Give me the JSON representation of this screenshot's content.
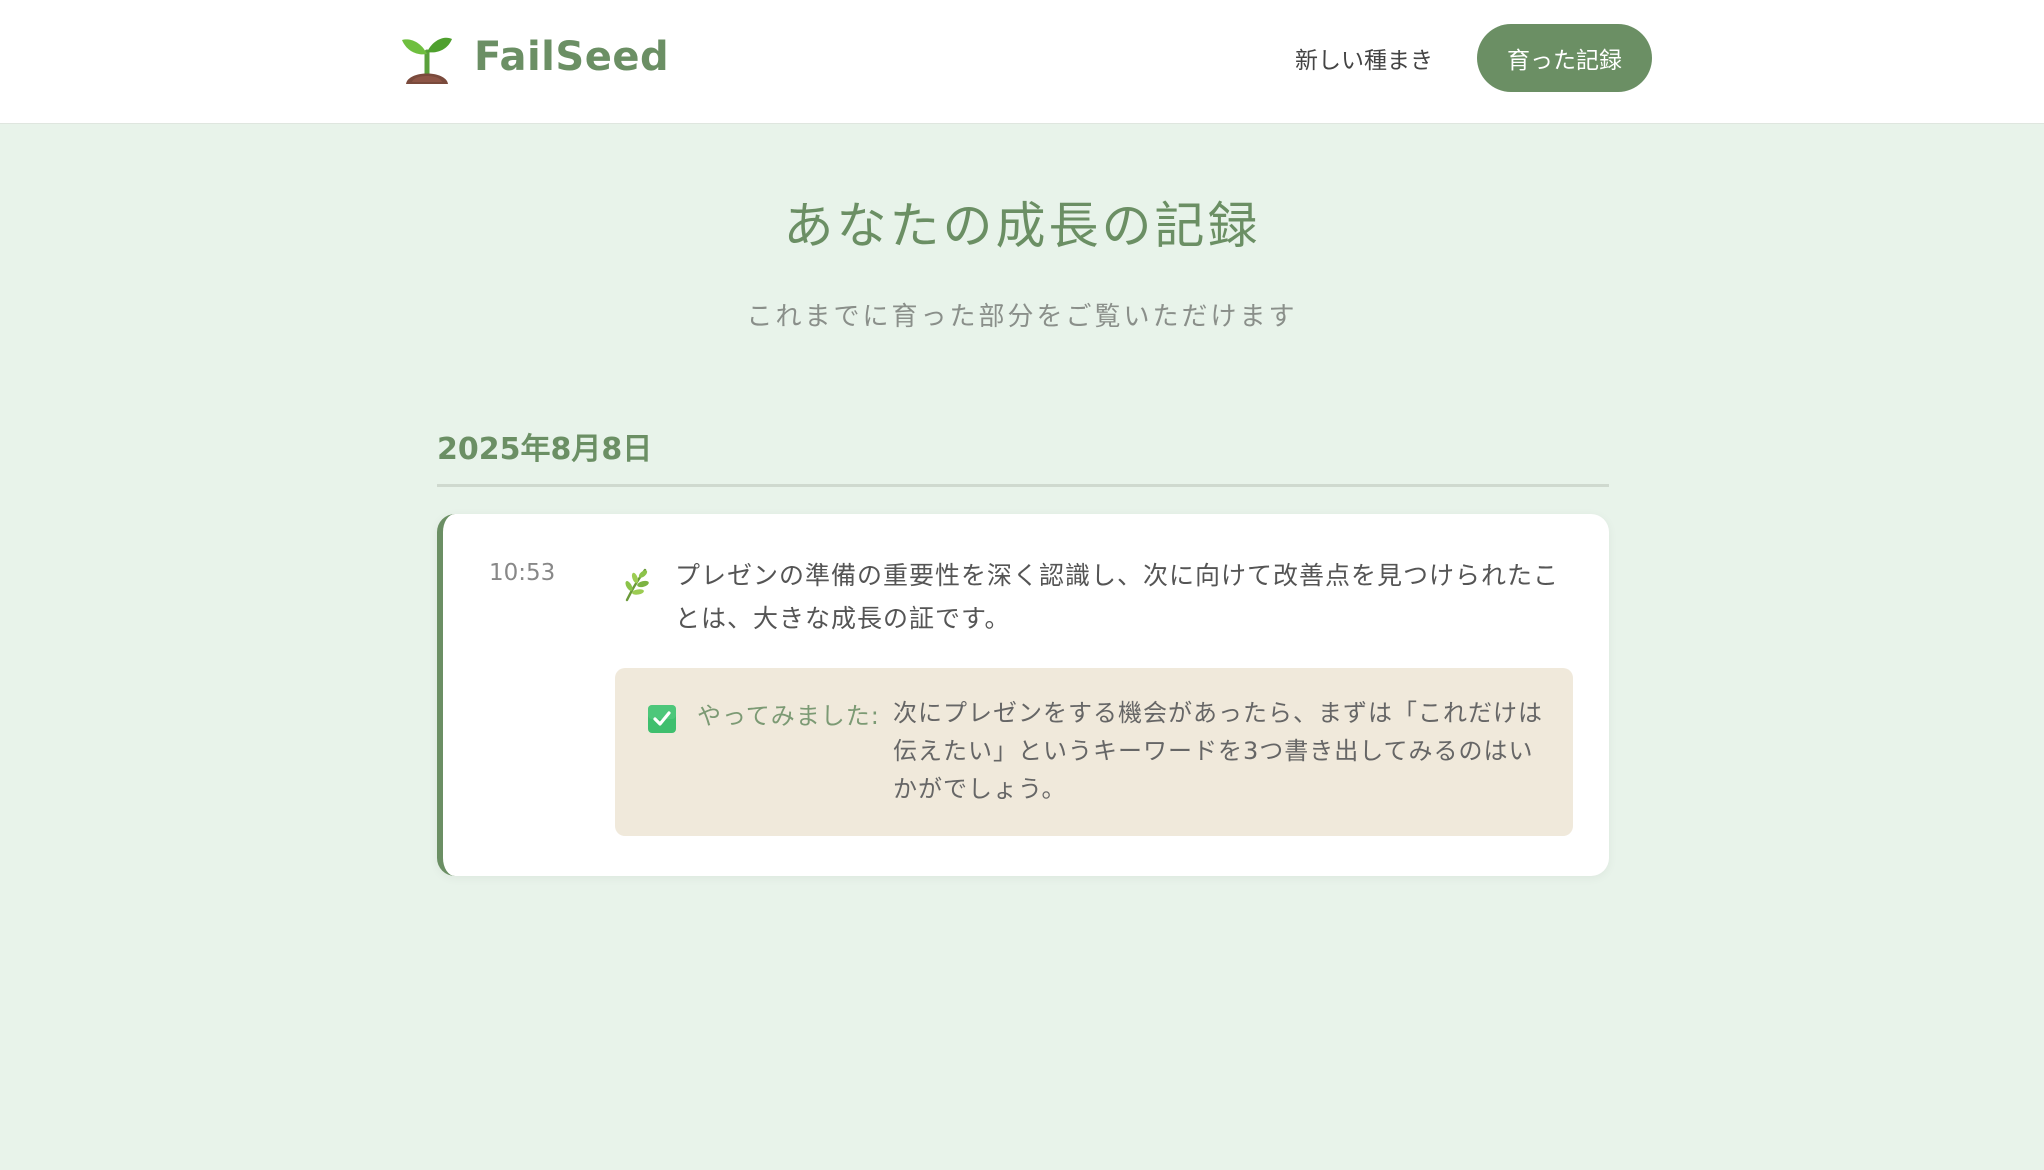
{
  "header": {
    "logo_text": "FailSeed",
    "nav": {
      "new_seed": "新しい種まき",
      "records": "育った記録"
    }
  },
  "page": {
    "title": "あなたの成長の記録",
    "subtitle": "これまでに育った部分をご覧いただけます"
  },
  "entries_group": {
    "date": "2025年8月8日",
    "entries": [
      {
        "time": "10:53",
        "text": "プレゼンの準備の重要性を深く認識し、次に向けて改善点を見つけられたことは、大きな成長の証です。",
        "action_label": "やってみました:",
        "action_text": "次にプレゼンをする機会があったら、まずは「これだけは伝えたい」というキーワードを3つ書き出してみるのはいかがでしょう。"
      }
    ]
  },
  "icons": {
    "logo": "seedling-icon",
    "entry": "sprout-icon",
    "action": "check-box-icon"
  },
  "colors": {
    "brand_green": "#6b8f64",
    "page_bg": "#e8f3ea",
    "action_bg": "#f0e9db",
    "check_green": "#3fbf6e"
  }
}
